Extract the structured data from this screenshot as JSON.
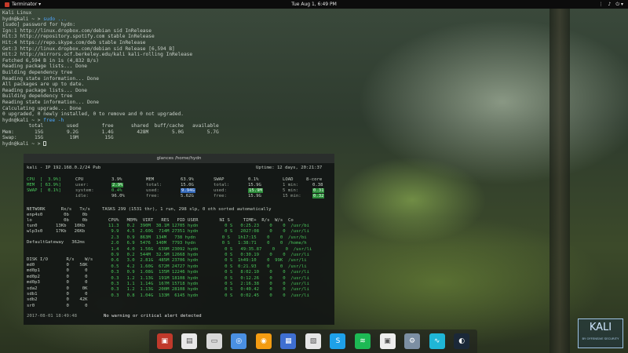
{
  "topbar": {
    "app_name": "Terminator ▾",
    "clock": "Tue Aug 1,  6:49 PM",
    "tray": [
      "⋮",
      "♪",
      "⏻ ▾"
    ]
  },
  "terminal": {
    "lines": [
      {
        "text": "Kali Linux",
        "cmd": ""
      },
      {
        "text": "hydn@kali ~ > ",
        "cmd": "sudo ..."
      },
      {
        "text": "[sudo] password for hydn:",
        "cmd": ""
      },
      {
        "text": "Ign:1 http://linux.dropbox.com/debian sid InRelease",
        "cmd": ""
      },
      {
        "text": "Hit:3 http://repository.spotify.com stable InRelease",
        "cmd": ""
      },
      {
        "text": "Hit:4 https://repo.skype.com/deb stable InRelease",
        "cmd": ""
      },
      {
        "text": "Get:3 http://linux.dropbox.com/debian sid Release [6,594 B]",
        "cmd": ""
      },
      {
        "text": "Hit:2 http://mirrors.ocf.berkeley.edu/kali kali-rolling InRelease",
        "cmd": ""
      },
      {
        "text": "Fetched 6,594 B in 1s (4,832 B/s)",
        "cmd": ""
      },
      {
        "text": "Reading package lists... Done",
        "cmd": ""
      },
      {
        "text": "Building dependency tree",
        "cmd": ""
      },
      {
        "text": "Reading state information... Done",
        "cmd": ""
      },
      {
        "text": "All packages are up to date.",
        "cmd": ""
      },
      {
        "text": "Reading package lists... Done",
        "cmd": ""
      },
      {
        "text": "Building dependency tree",
        "cmd": ""
      },
      {
        "text": "Reading state information... Done",
        "cmd": ""
      },
      {
        "text": "Calculating upgrade... Done",
        "cmd": ""
      },
      {
        "text": "0 upgraded, 0 newly installed, 0 to remove and 0 not upgraded.",
        "cmd": ""
      },
      {
        "text": "hydn@kali ~ > ",
        "cmd": "free -h"
      },
      {
        "text": "         total        used        free      shared  buff/cache   available",
        "cmd": ""
      },
      {
        "text": "Mem:       15G        9.2G        1.4G        428M        5.0G        5.7G",
        "cmd": ""
      },
      {
        "text": "Swap:      15G         19M         15G",
        "cmd": ""
      },
      {
        "text": "hydn@kali ~ > ",
        "cmd": ""
      }
    ]
  },
  "glances": {
    "title": "glances /home/hydn",
    "host": "kali - IP 192.168.0.2/24 Pub",
    "uptime": "Uptime: 12 days, 20:21:37",
    "cpu_block": [
      "CPU  [  3.9%]",
      "MEM  [ 63.9%]",
      "SWAP [  0.1%]"
    ],
    "cpu": {
      "label": "CPU",
      "total": "3.9%",
      "user_label": "user:",
      "user": "2.9%",
      "system_label": "system:",
      "system": "0.4%",
      "idle_label": "idle:",
      "idle": "96.0%"
    },
    "mem": {
      "label": "MEM",
      "pct": "63.9%",
      "total_label": "total:",
      "total": "15.0G",
      "used_label": "used:",
      "used": "9.94G",
      "free_label": "free:",
      "free": "5.62G"
    },
    "swap": {
      "label": "SWAP",
      "pct": "0.1%",
      "total_label": "total:",
      "total": "15.9G",
      "used_label": "used:",
      "used": "15.9M",
      "free_label": "free:",
      "free": "15.9G"
    },
    "load": {
      "label": "LOAD",
      "cores": "8-core",
      "m1_label": "1 min:",
      "m1": "0.38",
      "m5_label": "5 min:",
      "m5": "0.31",
      "m15_label": "15 min:",
      "m15": "0.32"
    },
    "network_header": "NETWORK      Rx/s   Tx/s",
    "network": [
      "enp4s0        0b     0b",
      "lo            0b     0b",
      "tun0       13Kb   10Kb",
      "wlp3s0     17Kb   26Kb",
      "",
      "DefaultGateway   362ms"
    ],
    "tasks": "TASKS 299 (1531 thr), 1 run, 298 slp, 0 oth sorted automatically",
    "proc_header": "CPU%   MEM%  VIRT   RES   PID USER        NI S     TIME+  R/s  W/s  Co",
    "procs": [
      "11.3   0.2  390M  38.1M 12705 hydn          0 S   0:25.23    0    0  /usr/bi",
      " 9.9   4.5  2.60G  714M 27351 hydn          0 S   2027:08    0    0  /usr/li",
      " 2.3   0.9  863M  134M   738 hydn          0 S   1h17:15    0    0  /usr/bi",
      " 2.0   6.9  5476  140M  7793 hydn          0 S   1:38:71    0    0  /home/h",
      " 1.4   4.0  1.56G  639M 23092 hydn          0 S   49:35.87    0    0  /usr/li",
      " 0.9   0.2  544M  32.5M 12668 hydn          0 S   0:30.19    0    0  /usr/li",
      " 0.6   3.0  2.81G  485M 23706 hydn          0 S  1h49:10    0  99K  /usr/li",
      " 0.5   4.2  1.60G  672M 24727 hydn          0 S  0:21.93    0    0  /usr/li",
      " 0.3   0.9  1.08G  135M 12246 hydn          0 S   8:02.10    0    0  /usr/li",
      " 0.3   1.2  1.13G  191M 18108 hydn          0 S   0:12.26    0    0  /usr/li",
      " 0.3   1.1  1.14G  167M 15718 hydn          0 S   2:16.38    0    0  /usr/li",
      " 0.3   1.2  1.13G  200M 28108 hydn          0 S   0:40.42    0    0  /usr/li",
      " 0.3   0.8  1.04G  133M  6145 hydn          0 S   0:02.45    0    0  /usr/li"
    ],
    "disk_header": "DISK I/O       R/s    W/s",
    "disks": [
      "md0            0    58K",
      "md0p1          0      0",
      "md0p2          0      0",
      "md0p3          0      0",
      "sda2           0     0K",
      "sdb1           0      0",
      "sdb2           0    42K",
      "sr0            0      0"
    ],
    "timestamp": "2017-08-01 18:49:48",
    "alert": "No warning or critical alert detected"
  },
  "dock": {
    "items": [
      {
        "name": "terminator",
        "glyph": "▣",
        "color": "#c0392b"
      },
      {
        "name": "document-viewer",
        "glyph": "▤",
        "color": "#e8e8e8"
      },
      {
        "name": "files",
        "glyph": "▭",
        "color": "#d8d8d8"
      },
      {
        "name": "chromium",
        "glyph": "◎",
        "color": "#4a90e2"
      },
      {
        "name": "firefox",
        "glyph": "◉",
        "color": "#f39c12"
      },
      {
        "name": "contacts",
        "glyph": "▦",
        "color": "#3f6fd1"
      },
      {
        "name": "image-viewer",
        "glyph": "▧",
        "color": "#e6e6e6"
      },
      {
        "name": "skype",
        "glyph": "S",
        "color": "#1ea1e8"
      },
      {
        "name": "spotify",
        "glyph": "≋",
        "color": "#1db954"
      },
      {
        "name": "software-center",
        "glyph": "▣",
        "color": "#eeeeee"
      },
      {
        "name": "settings",
        "glyph": "⚙",
        "color": "#7c8fa3"
      },
      {
        "name": "system-monitor",
        "glyph": "∿",
        "color": "#1fb6d6"
      },
      {
        "name": "steam",
        "glyph": "◐",
        "color": "#1b2838"
      }
    ]
  },
  "branding": {
    "logo_text": "KALI",
    "logo_sub": "BY OFFENSIVE SECURITY"
  }
}
